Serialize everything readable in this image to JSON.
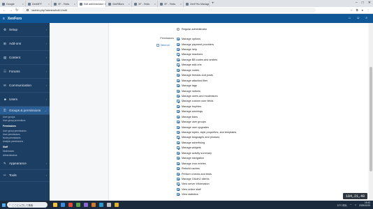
{
  "browser": {
    "tabs": [
      {
        "label": "Google"
      },
      {
        "label": "DevMFF"
      },
      {
        "label": "XF - Tests"
      },
      {
        "label": "Edit administrator: bolt | XenF"
      },
      {
        "label": "XenRBors"
      },
      {
        "label": "XF - Tests"
      },
      {
        "label": "XF - Tests"
      },
      {
        "label": "XenF/Ku Manage >"
      }
    ],
    "address": "/admin.php?admins/bolt.1/edit"
  },
  "sidebar": {
    "logo": "XenForo",
    "sections": [
      {
        "label": "Setup"
      },
      {
        "label": "Add-ons"
      },
      {
        "label": "Content"
      },
      {
        "label": "Forums"
      },
      {
        "label": "Communication"
      },
      {
        "label": "Users"
      },
      {
        "label": "Groups & permissions"
      }
    ],
    "group_links": [
      "User groups",
      "User group promotions"
    ],
    "permissions_header": "Permissions",
    "permission_links": [
      "User group permissions",
      "User permissions",
      "Node permissions",
      "Analytic permissions"
    ],
    "staff_header": "Staff",
    "staff_links": [
      "Moderators",
      "Administrators"
    ],
    "bottom_sections": [
      {
        "label": "Appearance"
      },
      {
        "label": "Tools"
      }
    ]
  },
  "form": {
    "permissions_label": "Permissions",
    "select_all": "Select all",
    "regular_admin": "Regular administrator",
    "permissions": [
      "Manage options",
      "Manage payment providers",
      "Manage help",
      "Manage reactions",
      "Manage BB codes and smilies",
      "Manage add-ons",
      "Manage nodes",
      "Manage threads and posts",
      "Manage attached files",
      "Manage tags",
      "Manage notices",
      "Manage users and moderators",
      "Manage custom user fields",
      "Manage trophies",
      "Manage warnings",
      "Manage bans",
      "Manage user groups",
      "Manage user upgrades",
      "Manage styles, style properties, and templates",
      "Manage languages and phrases",
      "Manage advertising",
      "Manage widgets",
      "Manage activity summary",
      "Manage navigation",
      "Manage cron entries",
      "Rebuild caches",
      "Perform checks and tests",
      "Manage OAuth2 clients",
      "View server information",
      "View online staff",
      "View statistics"
    ]
  },
  "taskbar": {
    "search_placeholder": "ここに入力して検索",
    "time": "15:43",
    "date": "2025/03/19",
    "temp": "11°C 晴れ"
  },
  "overlay": "104,21,48"
}
